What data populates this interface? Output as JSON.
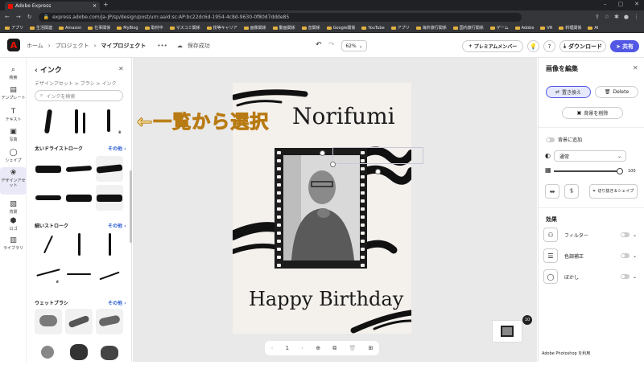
{
  "browser": {
    "tab_title": "Adobe Express",
    "url": "express.adobe.com/ja-JP/sp/design/post/urn:aaid:sc:AP:bc22dc6d-1954-4c8d-9630-0f80d7ddde85",
    "bookmarks": [
      "アプリ",
      "生活関連",
      "Amazon",
      "仕事関係",
      "MyBlog",
      "取材中",
      "マスコミ関係",
      "技等キャリア",
      "画像関係",
      "動画関係",
      "音関係",
      "Google関係",
      "YouTube",
      "アプリ",
      "海外旅行関係",
      "国内旅行関係",
      "ゲーム",
      "Adobe",
      "VR",
      "料理関係",
      "AI"
    ]
  },
  "header": {
    "breadcrumb": [
      "ホーム",
      "プロジェクト",
      "マイプロジェクト"
    ],
    "more": "•••",
    "save_status": "保存成功",
    "zoom": "62%",
    "premium": "プレミアムメンバー",
    "download": "ダウンロード",
    "share": "共有"
  },
  "rail": [
    {
      "label": "検索",
      "icon": "search-icon"
    },
    {
      "label": "テンプレート",
      "icon": "template-icon"
    },
    {
      "label": "テキスト",
      "icon": "text-icon"
    },
    {
      "label": "写真",
      "icon": "photo-icon"
    },
    {
      "label": "シェイプ",
      "icon": "shape-icon"
    },
    {
      "label": "デザインアセット",
      "icon": "design-assets-icon"
    },
    {
      "label": "背景",
      "icon": "background-icon"
    },
    {
      "label": "ロゴ",
      "icon": "logo-icon"
    },
    {
      "label": "ライブラリ",
      "icon": "library-icon"
    }
  ],
  "left_panel": {
    "title": "インク",
    "breadcrumb": "デザインアセット > ブラシ > インク",
    "search_placeholder": "インクを検索",
    "sections": [
      {
        "title": "太いドライストローク",
        "more": "その他 ›"
      },
      {
        "title": "細いストローク",
        "more": "その他 ›"
      },
      {
        "title": "ウェットブラシ",
        "more": "その他 ›"
      }
    ]
  },
  "canvas": {
    "overlay_annotation": "←一覧から選択",
    "card_name": "Norifumi",
    "card_message": "Happy Birthday",
    "page_number": "1",
    "page_count_badge": "10"
  },
  "right_panel": {
    "title": "画像を編集",
    "replace": "置き換え",
    "delete": "Delete",
    "remove_bg": "背景を削除",
    "add_bg": "背景に追加",
    "blend_mode": "通常",
    "opacity": "100",
    "crop": "切り抜き＆シェイプ",
    "effects_title": "効果",
    "effects": [
      "フィルター",
      "色調補正",
      "ぼかし"
    ],
    "footer": "Adobe Photoshop を利用"
  }
}
